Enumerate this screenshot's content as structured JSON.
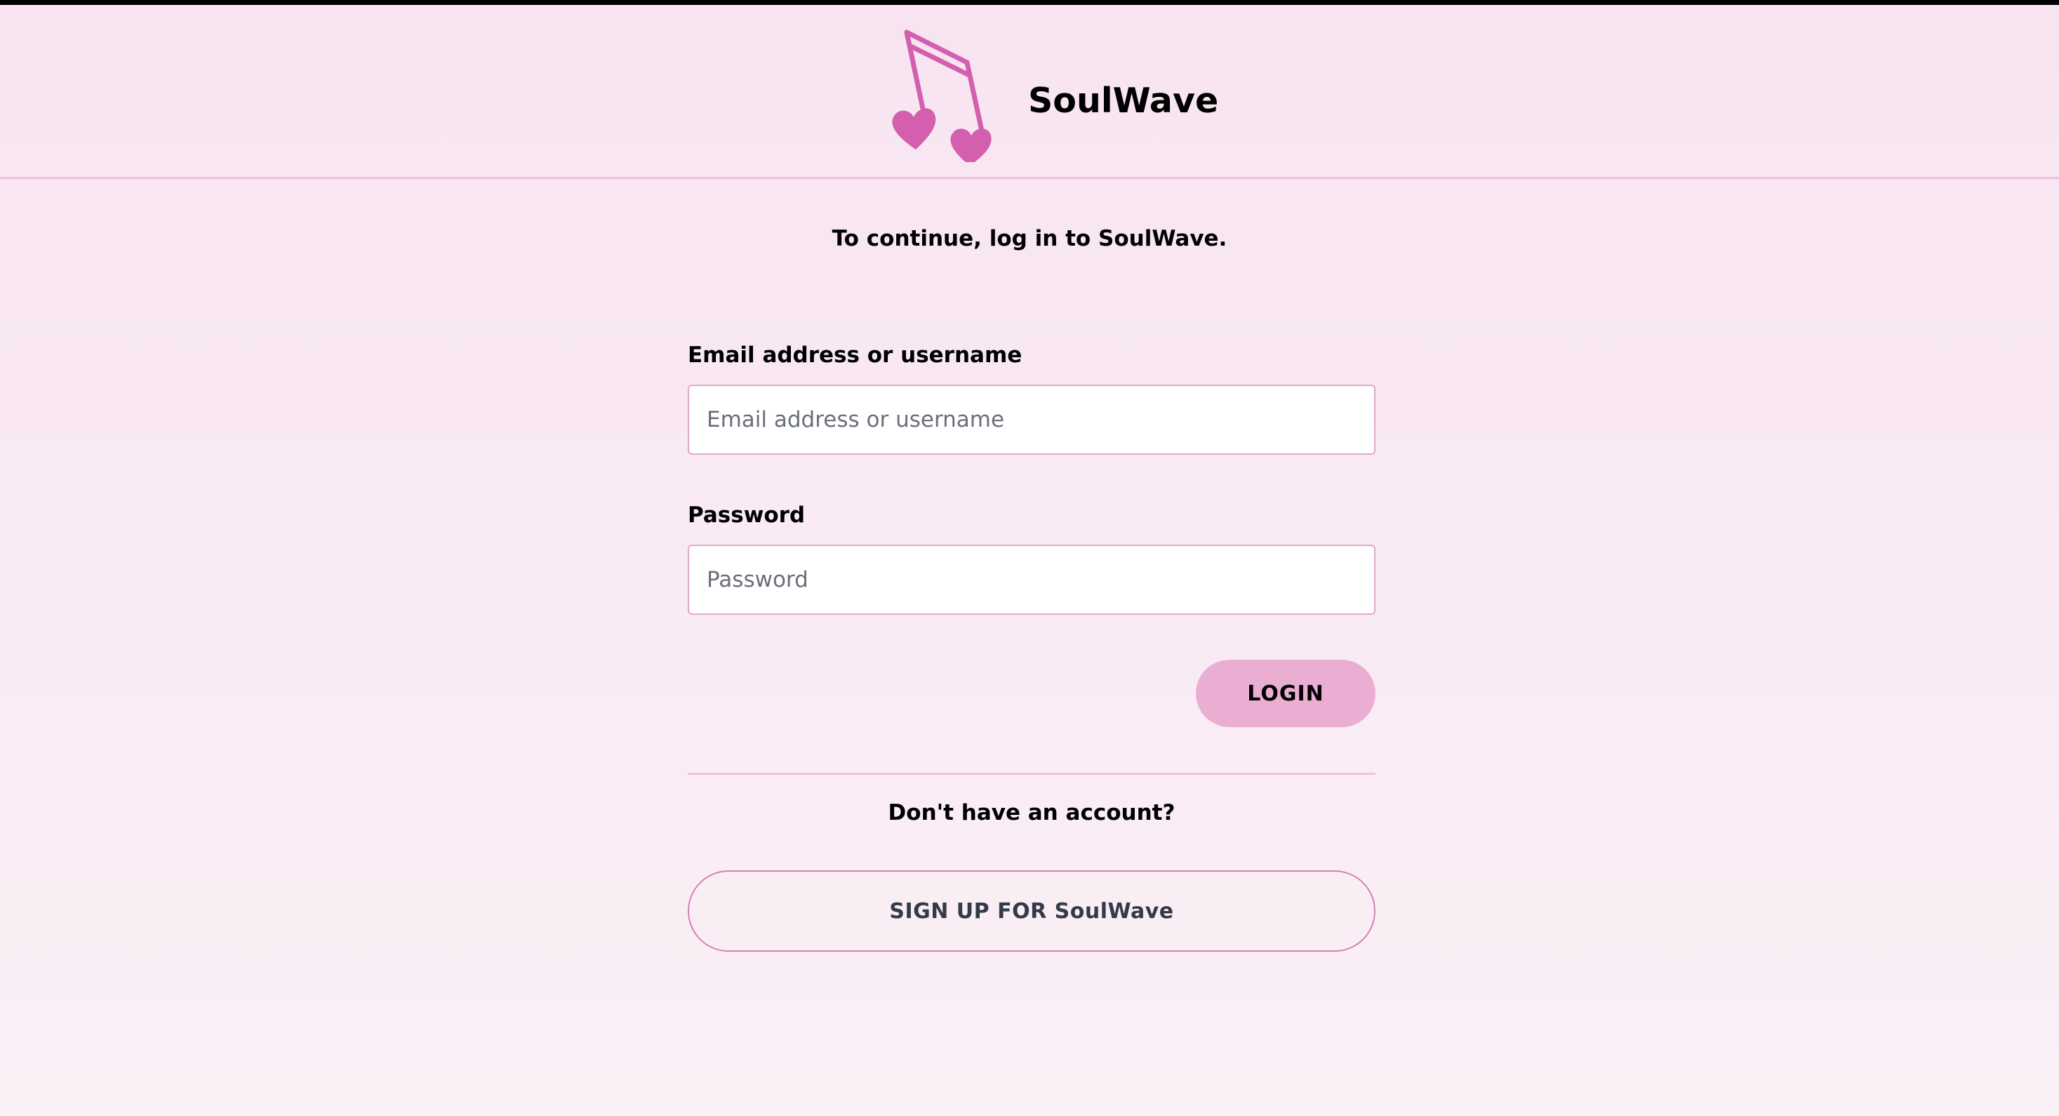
{
  "brand": {
    "name": "SoulWave",
    "logo_icon": "music-note-hearts-icon",
    "accent_color": "#d35fae"
  },
  "login": {
    "subtitle": "To continue, log in to SoulWave.",
    "email_label": "Email address or username",
    "email_placeholder": "Email address or username",
    "email_value": "",
    "password_label": "Password",
    "password_placeholder": "Password",
    "password_value": "",
    "login_button_label": "LOGIN"
  },
  "signup": {
    "prompt": "Don't have an account?",
    "button_label": "SIGN UP FOR SoulWave"
  },
  "colors": {
    "background_top": "#f8e4f1",
    "background_bottom": "#faf0f6",
    "login_button": "#ebaed3",
    "border": "#e0a8cb",
    "divider": "#efc3dd"
  }
}
